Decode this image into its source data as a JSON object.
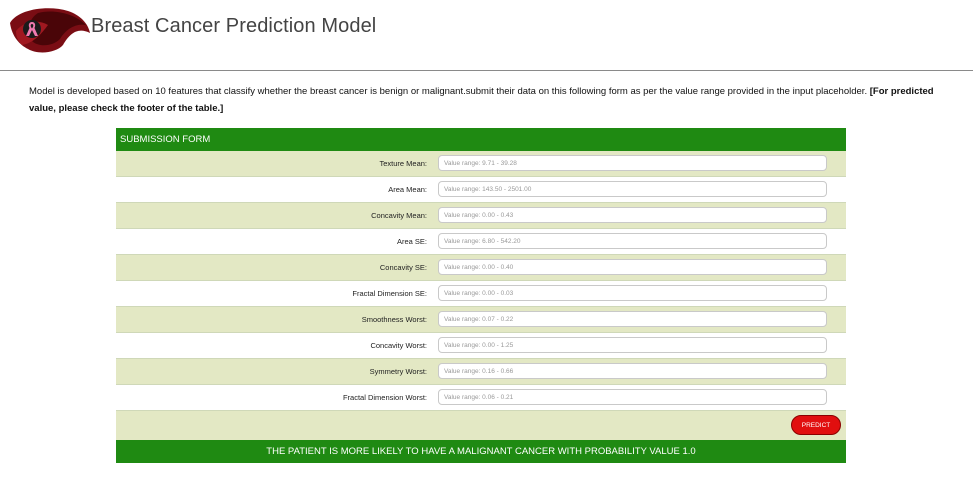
{
  "app": {
    "title": "Breast Cancer Prediction Model"
  },
  "intro": {
    "text": "Model is developed based on 10 features that classify whether the breast cancer is benign or malignant.submit their data on this following form as per the value range provided in the input placeholder. ",
    "note": "[For predicted value, please check the footer of the table.]"
  },
  "form": {
    "header": "SUBMISSION FORM",
    "fields": [
      {
        "label": "Texture Mean:",
        "placeholder": "Value range: 9.71 - 39.28"
      },
      {
        "label": "Area Mean:",
        "placeholder": "Value range: 143.50 - 2501.00"
      },
      {
        "label": "Concavity Mean:",
        "placeholder": "Value range: 0.00 - 0.43"
      },
      {
        "label": "Area SE:",
        "placeholder": "Value range: 6.80 - 542.20"
      },
      {
        "label": "Concavity SE:",
        "placeholder": "Value range: 0.00 - 0.40"
      },
      {
        "label": "Fractal Dimension SE:",
        "placeholder": "Value range: 0.00 - 0.03"
      },
      {
        "label": "Smoothness Worst:",
        "placeholder": "Value range: 0.07 - 0.22"
      },
      {
        "label": "Concavity Worst:",
        "placeholder": "Value range: 0.00 - 1.25"
      },
      {
        "label": "Symmetry Worst:",
        "placeholder": "Value range: 0.16 - 0.66"
      },
      {
        "label": "Fractal Dimension Worst:",
        "placeholder": "Value range: 0.06 - 0.21"
      }
    ],
    "predict_label": "PREDICT",
    "result": "THE PATIENT IS MORE LIKELY TO HAVE A MALIGNANT CANCER WITH PROBABILITY VALUE 1.0"
  },
  "icons": {
    "logo": "pink-ribbon-logo"
  },
  "colors": {
    "accent_green": "#1f8a12",
    "row_shade": "#e3e8c4",
    "predict_red": "#e10f0f"
  }
}
